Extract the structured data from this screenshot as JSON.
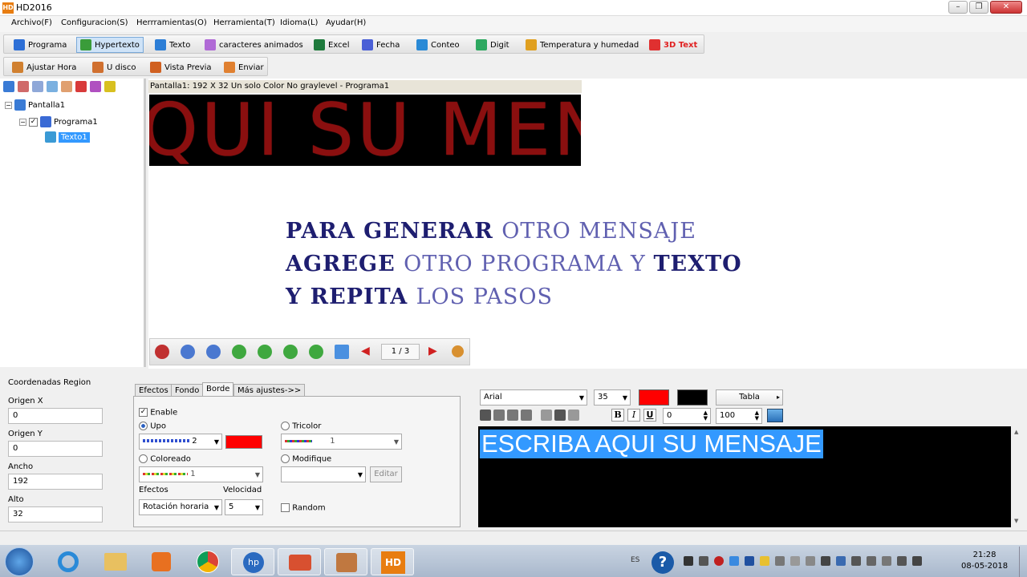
{
  "window": {
    "title": "HD2016",
    "icon": "hd-app-icon"
  },
  "menu": [
    "Archivo(F)",
    "Configuracion(S)",
    "Herrramientas(O)",
    "Herramienta(T)",
    "Idioma(L)",
    "Ayudar(H)"
  ],
  "toolbar1": [
    {
      "label": "Programa",
      "icon": "program-icon",
      "color": "#2d6fd6"
    },
    {
      "label": "Hypertexto",
      "icon": "hypertext-icon",
      "color": "#3a9c3a"
    },
    {
      "label": "Texto",
      "icon": "text-icon",
      "color": "#2d7ed6"
    },
    {
      "label": "caracteres animados",
      "icon": "animated-chars-icon",
      "color": "#b06ad6"
    },
    {
      "label": "Excel",
      "icon": "excel-icon",
      "color": "#1e7a3c"
    },
    {
      "label": "Fecha",
      "icon": "clock-icon",
      "color": "#4a5fd6"
    },
    {
      "label": "Conteo",
      "icon": "counter-icon",
      "color": "#2a8ad6"
    },
    {
      "label": "Digit",
      "icon": "digit-icon",
      "color": "#2da860"
    },
    {
      "label": "Temperatura y humedad",
      "icon": "thermometer-icon",
      "color": "#e0a020"
    },
    {
      "label": "3D Text",
      "icon": "3d-cube-icon",
      "color": "#e03030"
    }
  ],
  "toolbar2": [
    {
      "label": "Ajustar Hora",
      "icon": "adjust-time-icon",
      "color": "#d08030"
    },
    {
      "label": "U disco",
      "icon": "usb-disk-icon",
      "color": "#d07030"
    },
    {
      "label": "Vista Previa",
      "icon": "preview-icon",
      "color": "#d06020"
    },
    {
      "label": "Enviar",
      "icon": "send-icon",
      "color": "#e08030"
    }
  ],
  "tree": {
    "root": "Pantalla1",
    "program": "Programa1",
    "text": "Texto1"
  },
  "screen": {
    "label": "Pantalla1: 192 X 32  Un solo Color No graylevel - Programa1",
    "led_text": "QUI SU MENSA",
    "instructions": [
      [
        {
          "t": "PARA ",
          "s": "bd"
        },
        {
          "t": "GENERAR ",
          "s": "bd2"
        },
        {
          "t": "OTRO MENSAJE",
          "s": "lt"
        }
      ],
      [
        {
          "t": "AGREGE ",
          "s": "bd"
        },
        {
          "t": "OTRO ",
          "s": "lt"
        },
        {
          "t": "PROGRAMA Y ",
          "s": "lt"
        },
        {
          "t": "TEXTO",
          "s": "bd"
        }
      ],
      [
        {
          "t": "Y REPITA ",
          "s": "bd"
        },
        {
          "t": "LOS PASOS",
          "s": "lt"
        }
      ]
    ]
  },
  "playback": {
    "page": "1 / 3"
  },
  "coords": {
    "title": "Coordenadas Region",
    "origin_x_label": "Origen X",
    "origin_x": "0",
    "origin_y_label": "Origen Y",
    "origin_y": "0",
    "width_label": "Ancho",
    "width": "192",
    "height_label": "Alto",
    "height": "32"
  },
  "effects": {
    "tabs": [
      "Efectos",
      "Fondo",
      "Borde",
      "Más ajustes->>"
    ],
    "enable": "Enable",
    "upo": "Upo",
    "upo_value": "2",
    "tricolor": "Tricolor",
    "tricolor_value": "1",
    "coloreado": "Coloreado",
    "coloreado_value": "1",
    "modifique": "Modifique",
    "editar": "Editar",
    "efectos_label": "Efectos",
    "efectos_value": "Rotación horaria",
    "velocidad_label": "Velocidad",
    "velocidad_value": "5",
    "random": "Random",
    "border_color": "#ff0000"
  },
  "editor": {
    "font": "Arial",
    "size": "35",
    "fg": "#ff0000",
    "bg": "#000000",
    "table": "Tabla",
    "spacing": "0",
    "scale": "100",
    "text": "ESCRIBA AQUI SU MENSAJE"
  },
  "taskbar": {
    "lang": "ES",
    "time": "21:28",
    "date": "08-05-2018"
  }
}
